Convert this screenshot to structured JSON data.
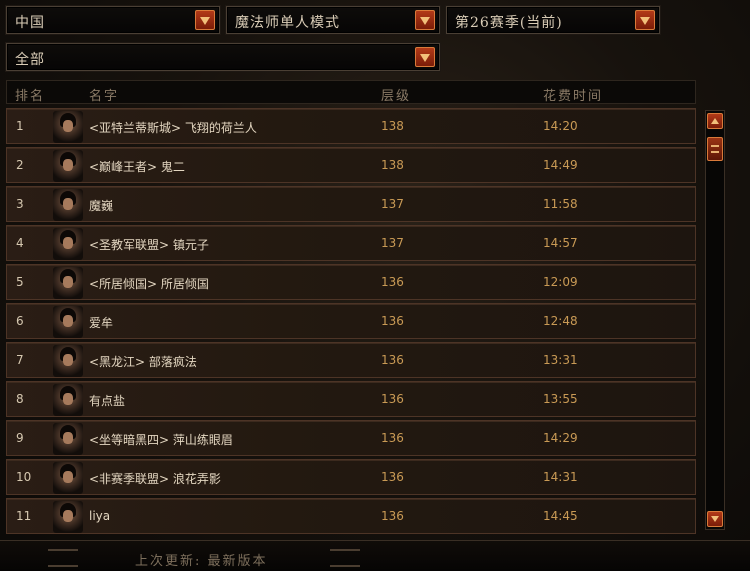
{
  "filters": {
    "region": "中国",
    "mode": "魔法师单人模式",
    "season": "第26赛季(当前)",
    "class_filter": "全部"
  },
  "columns": {
    "rank": "排名",
    "name": "名字",
    "level": "层级",
    "time": "花费时间"
  },
  "rows": [
    {
      "rank": "1",
      "name": "<亚特兰蒂斯城> 飞翔的荷兰人",
      "level": "138",
      "time": "14:20"
    },
    {
      "rank": "2",
      "name": "<巅峰王者> 鬼二",
      "level": "138",
      "time": "14:49"
    },
    {
      "rank": "3",
      "name": "魔巍",
      "level": "137",
      "time": "11:58"
    },
    {
      "rank": "4",
      "name": "<圣教军联盟> 镇元子",
      "level": "137",
      "time": "14:57"
    },
    {
      "rank": "5",
      "name": "<所居倾国> 所居倾国",
      "level": "136",
      "time": "12:09"
    },
    {
      "rank": "6",
      "name": "爱牟",
      "level": "136",
      "time": "12:48"
    },
    {
      "rank": "7",
      "name": "<黑龙江> 部落疯法",
      "level": "136",
      "time": "13:31"
    },
    {
      "rank": "8",
      "name": "有点盐",
      "level": "136",
      "time": "13:55"
    },
    {
      "rank": "9",
      "name": "<坐等暗黑四> 萍山练眼眉",
      "level": "136",
      "time": "14:29"
    },
    {
      "rank": "10",
      "name": "<非赛季联盟> 浪花弄影",
      "level": "136",
      "time": "14:31"
    },
    {
      "rank": "11",
      "name": "liya",
      "level": "136",
      "time": "14:45"
    }
  ],
  "footer": {
    "last_update": "上次更新: 最新版本"
  },
  "icons": {
    "dropdown": "chevron-down-icon",
    "scroll_up": "arrow-up-icon",
    "scroll_down": "arrow-down-icon"
  },
  "colors": {
    "accent": "#b23a18",
    "value_text": "#c99a55"
  }
}
